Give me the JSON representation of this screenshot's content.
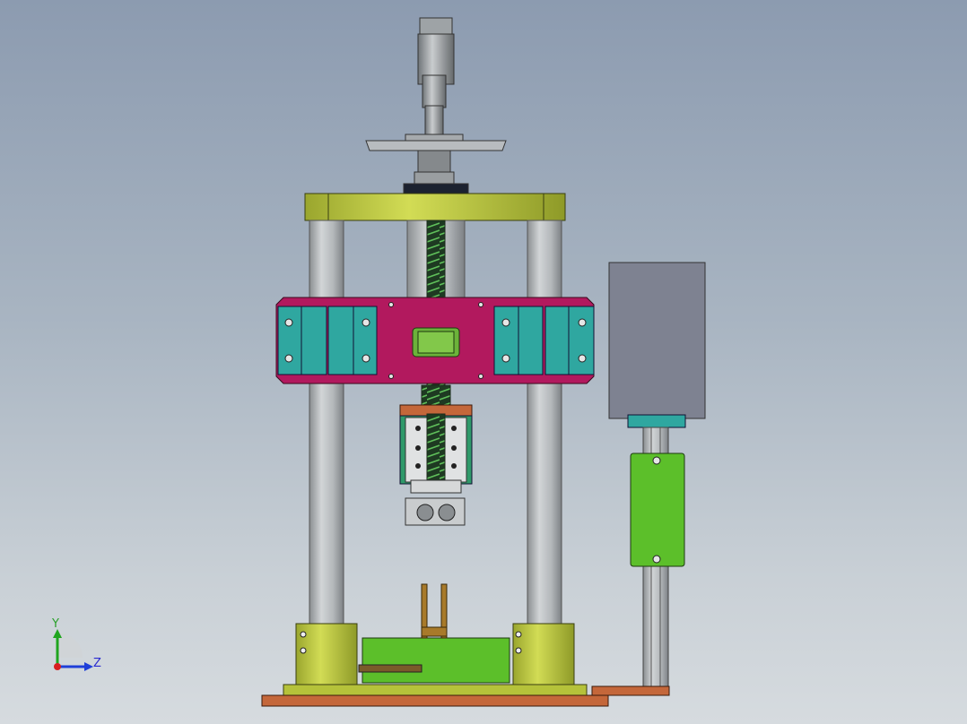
{
  "triad": {
    "y_label": "Y",
    "z_label": "Z",
    "colors": {
      "y": "#1fa51f",
      "z": "#1f3fd8",
      "x": "#d81f1f"
    }
  },
  "palette": {
    "top_plate": "#b5c23a",
    "column": "#b4b8bb",
    "moving_plate": "#b2195e",
    "bearing_block": "#2fa7a0",
    "screw": "#2f6b3a",
    "motor_box": "#7e8291",
    "slide_plate": "#5cbf2a",
    "base_plate": "#c4673a"
  }
}
